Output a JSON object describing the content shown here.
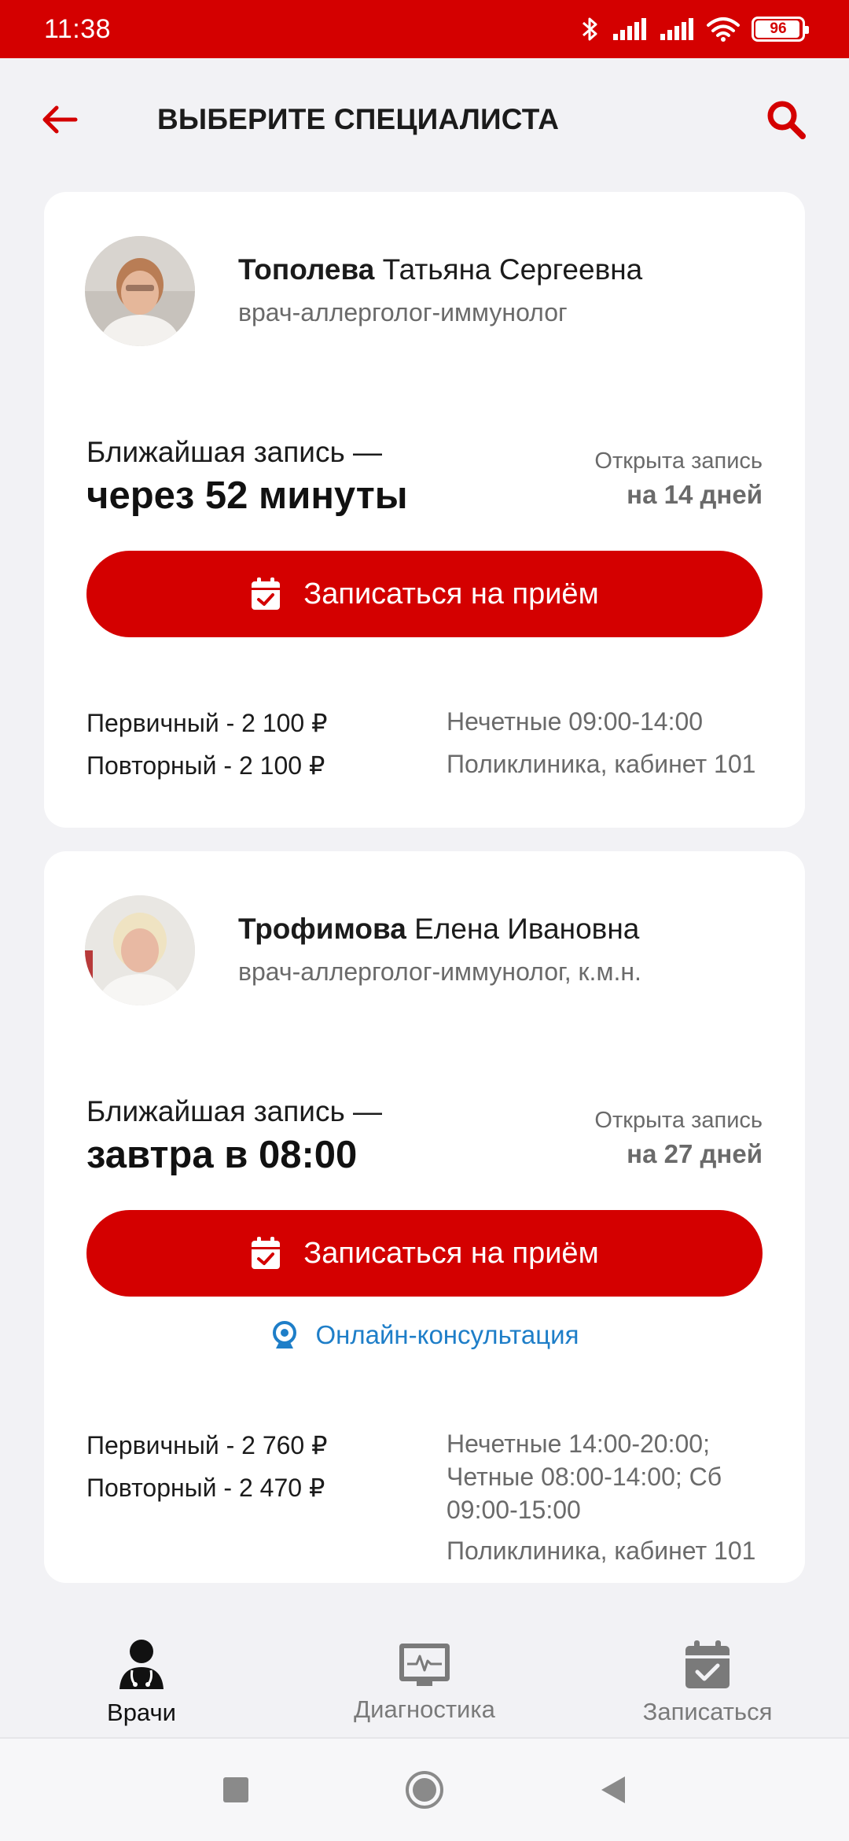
{
  "status_bar": {
    "time": "11:38",
    "battery": "96",
    "battery_level": 0.96
  },
  "header": {
    "title": "ВЫБЕРИТЕ СПЕЦИАЛИСТА"
  },
  "doctors": [
    {
      "surname": "Тополева",
      "given": "Татьяна Сергеевна",
      "specialty": "врач-аллерголог-иммунолог",
      "next_label": "Ближайшая запись —",
      "next_value": "через 52 минуты",
      "open_label": "Открыта запись",
      "open_value": "на 14 дней",
      "book_label": "Записаться на приём",
      "price_primary": "Первичный - 2 100 ₽",
      "price_repeat": "Повторный - 2 100 ₽",
      "schedule": "Нечетные 09:00-14:00",
      "location": "Поликлиника, кабинет 101"
    },
    {
      "surname": "Трофимова",
      "given": "Елена Ивановна",
      "specialty": "врач-аллерголог-иммунолог, к.м.н.",
      "next_label": "Ближайшая запись —",
      "next_value": "завтра в 08:00",
      "open_label": "Открыта запись",
      "open_value": "на 27 дней",
      "book_label": "Записаться на приём",
      "online_label": "Онлайн-консультация",
      "price_primary": "Первичный - 2 760 ₽",
      "price_repeat": "Повторный - 2 470 ₽",
      "schedule_lines": [
        "Нечетные 14:00-20:00;",
        "Четные 08:00-14:00;  Сб",
        "09:00-15:00"
      ],
      "location": "Поликлиника, кабинет 101"
    }
  ],
  "bottom_nav": {
    "items": [
      {
        "label": "Врачи",
        "icon": "doctor-icon",
        "active": true
      },
      {
        "label": "Диагностика",
        "icon": "monitor-pulse-icon",
        "active": false
      },
      {
        "label": "Записаться",
        "icon": "calendar-check-icon",
        "active": false
      }
    ]
  },
  "colors": {
    "brand_red": "#d40000",
    "link_blue": "#1e7ec8",
    "background": "#f2f2f5"
  }
}
